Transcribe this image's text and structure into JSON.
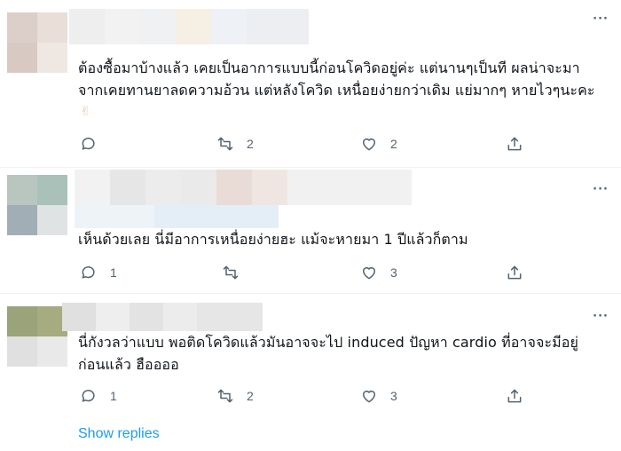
{
  "replies": [
    {
      "text": "ต้องซื้อมาบ้างแล้ว เคยเป็นอาการแบบนี้ก่อนโควิดอยู่ค่ะ แต่นานๆเป็นที ผลน่าจะมา\nจากเคยทานยาลดความอ้วน แต่หลังโควิด เหนื่อยง่ายกว่าเดิม แย่มากๆ หายไวๆนะคะ",
      "emoji": "✌",
      "more": "···",
      "retweets": "2",
      "likes": "2",
      "comments": ""
    },
    {
      "text": "เห็นด้วยเลย นี่มีอาการเหนื่อยง่ายฮะ แม้จะหายมา 1 ปีแล้วก็ตาม",
      "more": "···",
      "comments": "1",
      "retweets": "",
      "likes": "3"
    },
    {
      "text": "นี่กังวลว่าแบบ พอติดโควิดแล้วมันอาจจะไป induced ปัญหา cardio ที่อาจจะมีอยู่\nก่อนแล้ว ฮืออออ",
      "more": "···",
      "comments": "1",
      "retweets": "2",
      "likes": "3"
    }
  ],
  "show_replies": "Show replies",
  "colors": {
    "accent": "#1d9bf0",
    "muted": "#536471",
    "divider": "#eff3f4"
  },
  "icons": [
    "reply-icon",
    "retweet-icon",
    "like-icon",
    "share-icon",
    "more-icon"
  ]
}
